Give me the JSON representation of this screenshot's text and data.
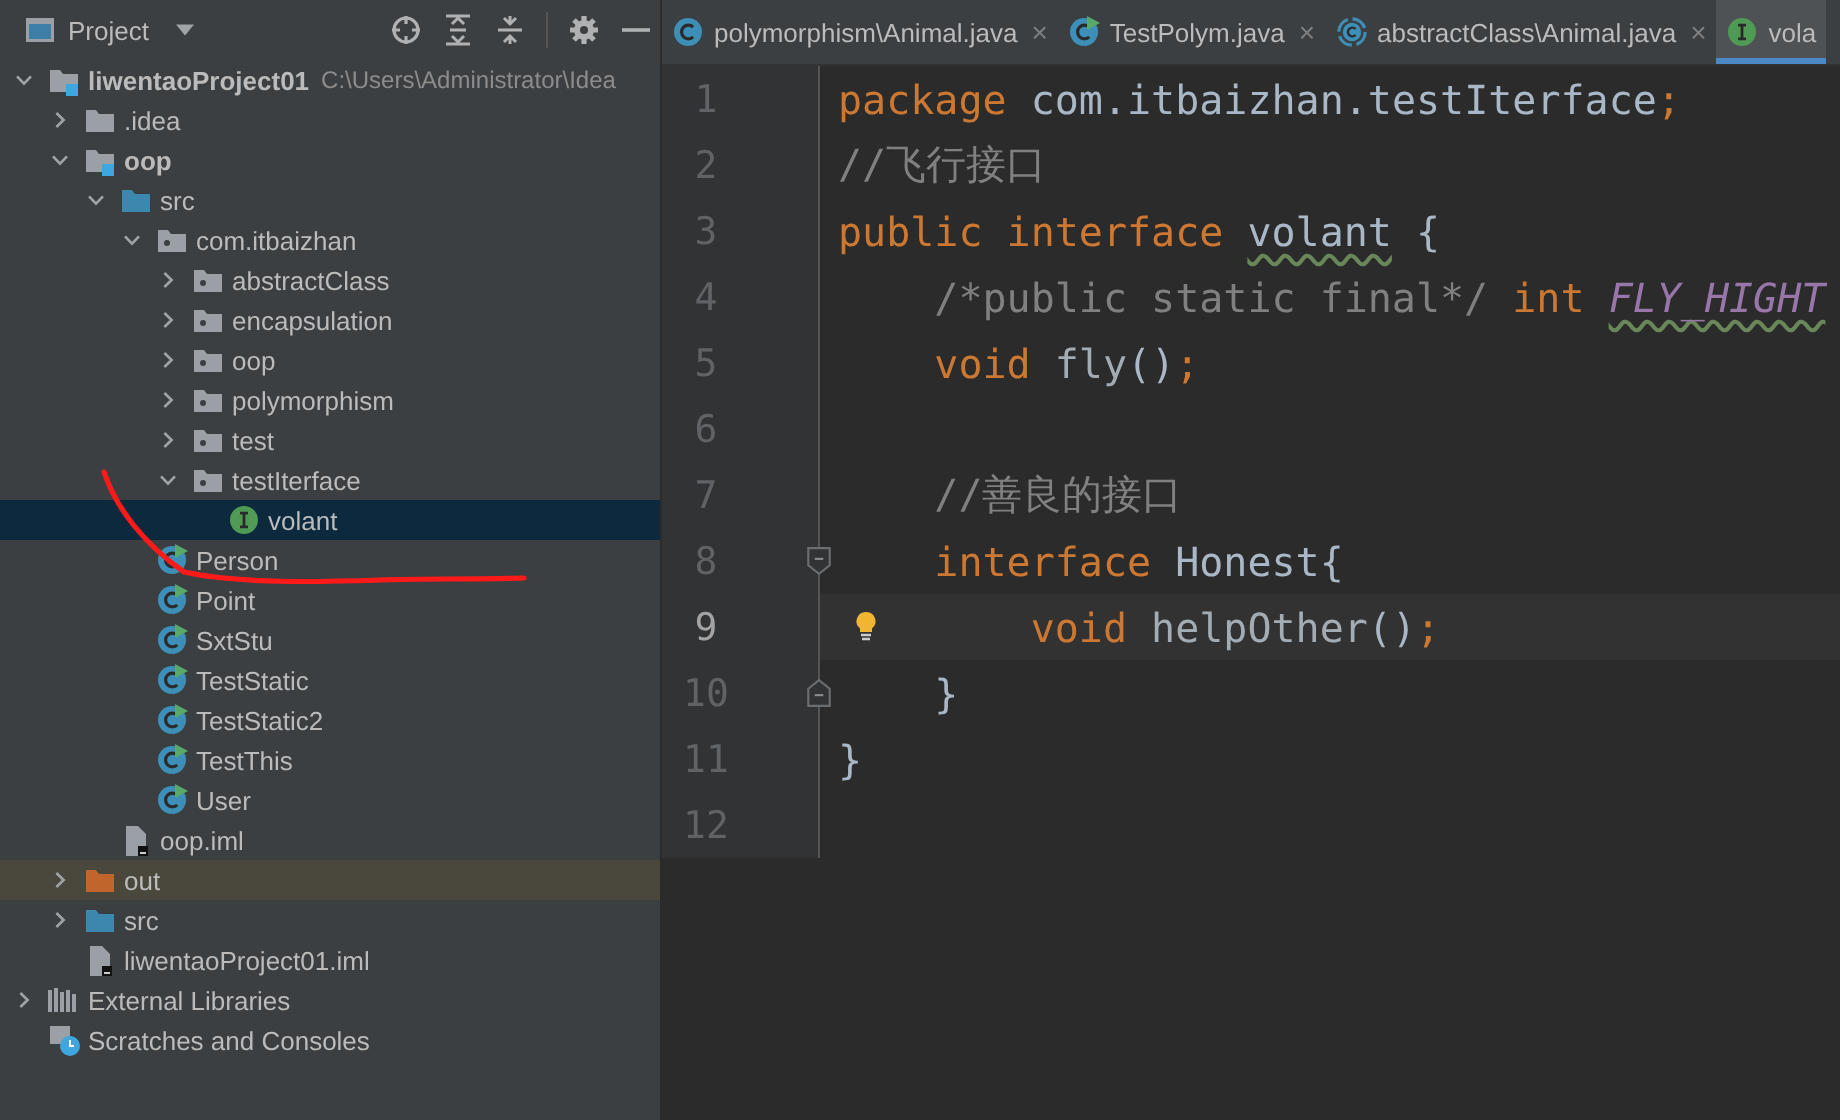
{
  "panel": {
    "title": "Project",
    "tools": [
      {
        "kind": "locate"
      },
      {
        "kind": "expand"
      },
      {
        "kind": "collapse"
      },
      {
        "kind": "settings"
      },
      {
        "kind": "hide"
      }
    ]
  },
  "tree": [
    {
      "label": "liwentaoProject01",
      "kind": "project",
      "hint": "C:\\Users\\Administrator\\Idea",
      "expanded": true,
      "selected": false,
      "highlighted": false,
      "children": [
        {
          "label": ".idea",
          "kind": "folder",
          "expanded": false,
          "selected": false,
          "highlighted": false
        },
        {
          "label": "oop",
          "kind": "module",
          "expanded": true,
          "selected": false,
          "highlighted": false,
          "children": [
            {
              "label": "src",
              "kind": "source-folder",
              "expanded": true,
              "selected": false,
              "highlighted": false,
              "children": [
                {
                  "label": "com.itbaizhan",
                  "kind": "package",
                  "expanded": true,
                  "selected": false,
                  "highlighted": false,
                  "children": [
                    {
                      "label": "abstractClass",
                      "kind": "package",
                      "expanded": false,
                      "selected": false,
                      "highlighted": false
                    },
                    {
                      "label": "encapsulation",
                      "kind": "package",
                      "expanded": false,
                      "selected": false,
                      "highlighted": false
                    },
                    {
                      "label": "oop",
                      "kind": "package",
                      "expanded": false,
                      "selected": false,
                      "highlighted": false
                    },
                    {
                      "label": "polymorphism",
                      "kind": "package",
                      "expanded": false,
                      "selected": false,
                      "highlighted": false
                    },
                    {
                      "label": "test",
                      "kind": "package",
                      "expanded": false,
                      "selected": false,
                      "highlighted": false
                    },
                    {
                      "label": "testIterface",
                      "kind": "package",
                      "expanded": true,
                      "selected": false,
                      "highlighted": false,
                      "children": [
                        {
                          "label": "volant",
                          "kind": "interface",
                          "selected": true,
                          "highlighted": false
                        }
                      ]
                    }
                  ]
                },
                {
                  "label": "Person",
                  "kind": "class-run",
                  "selected": false,
                  "highlighted": false
                },
                {
                  "label": "Point",
                  "kind": "class-run",
                  "selected": false,
                  "highlighted": false
                },
                {
                  "label": "SxtStu",
                  "kind": "class-run",
                  "selected": false,
                  "highlighted": false
                },
                {
                  "label": "TestStatic",
                  "kind": "class-run",
                  "selected": false,
                  "highlighted": false
                },
                {
                  "label": "TestStatic2",
                  "kind": "class-run",
                  "selected": false,
                  "highlighted": false
                },
                {
                  "label": "TestThis",
                  "kind": "class-run",
                  "selected": false,
                  "highlighted": false
                },
                {
                  "label": "User",
                  "kind": "class-run",
                  "selected": false,
                  "highlighted": false
                }
              ]
            },
            {
              "label": "oop.iml",
              "kind": "iml",
              "selected": false,
              "highlighted": false
            }
          ]
        },
        {
          "label": "out",
          "kind": "excluded-folder",
          "expanded": false,
          "selected": false,
          "highlighted": true
        },
        {
          "label": "src",
          "kind": "source-folder",
          "expanded": false,
          "selected": false,
          "highlighted": false
        },
        {
          "label": "liwentaoProject01.iml",
          "kind": "iml",
          "selected": false,
          "highlighted": false
        }
      ]
    },
    {
      "label": "External Libraries",
      "kind": "libraries",
      "expanded": false,
      "selected": false,
      "highlighted": false
    },
    {
      "label": "Scratches and Consoles",
      "kind": "scratches",
      "selected": false,
      "highlighted": false
    }
  ],
  "tabs": [
    {
      "label": "polymorphism\\Animal.java",
      "kind": "class",
      "close": "×",
      "selected": false
    },
    {
      "label": "TestPolym.java",
      "kind": "class-run",
      "close": "×",
      "selected": false
    },
    {
      "label": "abstractClass\\Animal.java",
      "kind": "abstract",
      "close": "×",
      "selected": false
    },
    {
      "label": "vola",
      "kind": "interface",
      "selected": true
    }
  ],
  "editor": {
    "lines": [
      {
        "number": "1",
        "current": false,
        "bulb": false,
        "tokens": [
          {
            "text": "package ",
            "kind": "keyword",
            "warning": false
          },
          {
            "text": "com.itbaizhan.testIterface",
            "kind": "plain",
            "warning": false
          },
          {
            "text": ";",
            "kind": "keyword",
            "warning": false
          }
        ]
      },
      {
        "number": "2",
        "current": false,
        "bulb": false,
        "tokens": [
          {
            "text": "//飞行接口",
            "kind": "comment",
            "warning": false
          }
        ]
      },
      {
        "number": "3",
        "current": false,
        "bulb": false,
        "tokens": [
          {
            "text": "public interface ",
            "kind": "keyword",
            "warning": false
          },
          {
            "text": "volant",
            "kind": "plain",
            "warning": true
          },
          {
            "text": " {",
            "kind": "plain",
            "warning": false
          }
        ]
      },
      {
        "number": "4",
        "current": false,
        "bulb": false,
        "tokens": [
          {
            "text": "    /*public static final*/ ",
            "kind": "comment",
            "warning": false
          },
          {
            "text": "int ",
            "kind": "keyword",
            "warning": false
          },
          {
            "text": "FLY_HIGHT",
            "kind": "constant",
            "warning": true
          }
        ]
      },
      {
        "number": "5",
        "current": false,
        "bulb": false,
        "tokens": [
          {
            "text": "    void ",
            "kind": "keyword",
            "warning": false
          },
          {
            "text": "fly",
            "kind": "method",
            "warning": false
          },
          {
            "text": "()",
            "kind": "plain",
            "warning": false
          },
          {
            "text": ";",
            "kind": "keyword",
            "warning": false
          }
        ]
      },
      {
        "number": "6",
        "current": false,
        "bulb": false
      },
      {
        "number": "7",
        "current": false,
        "bulb": false,
        "tokens": [
          {
            "text": "    //善良的接口",
            "kind": "comment",
            "warning": false
          }
        ]
      },
      {
        "number": "8",
        "current": false,
        "bulb": false,
        "fold_start": true,
        "tokens": [
          {
            "text": "    interface ",
            "kind": "keyword",
            "warning": false
          },
          {
            "text": "Honest",
            "kind": "plain",
            "warning": false
          },
          {
            "text": "{",
            "kind": "plain",
            "warning": false
          }
        ]
      },
      {
        "number": "9",
        "current": true,
        "bulb": true,
        "tokens": [
          {
            "text": "        void ",
            "kind": "keyword",
            "warning": false
          },
          {
            "text": "helpOther",
            "kind": "method",
            "warning": false
          },
          {
            "text": "()",
            "kind": "plain",
            "warning": false
          },
          {
            "text": ";",
            "kind": "keyword",
            "warning": false
          }
        ]
      },
      {
        "number": "10",
        "current": false,
        "bulb": false,
        "fold_end": true,
        "tokens": [
          {
            "text": "    }",
            "kind": "plain",
            "warning": false
          }
        ]
      },
      {
        "number": "11",
        "current": false,
        "bulb": false,
        "tokens": [
          {
            "text": "}",
            "kind": "plain",
            "warning": false
          }
        ]
      },
      {
        "number": "12",
        "current": false,
        "bulb": false
      }
    ]
  },
  "annotations": [
    {
      "kind": "stroke"
    }
  ]
}
